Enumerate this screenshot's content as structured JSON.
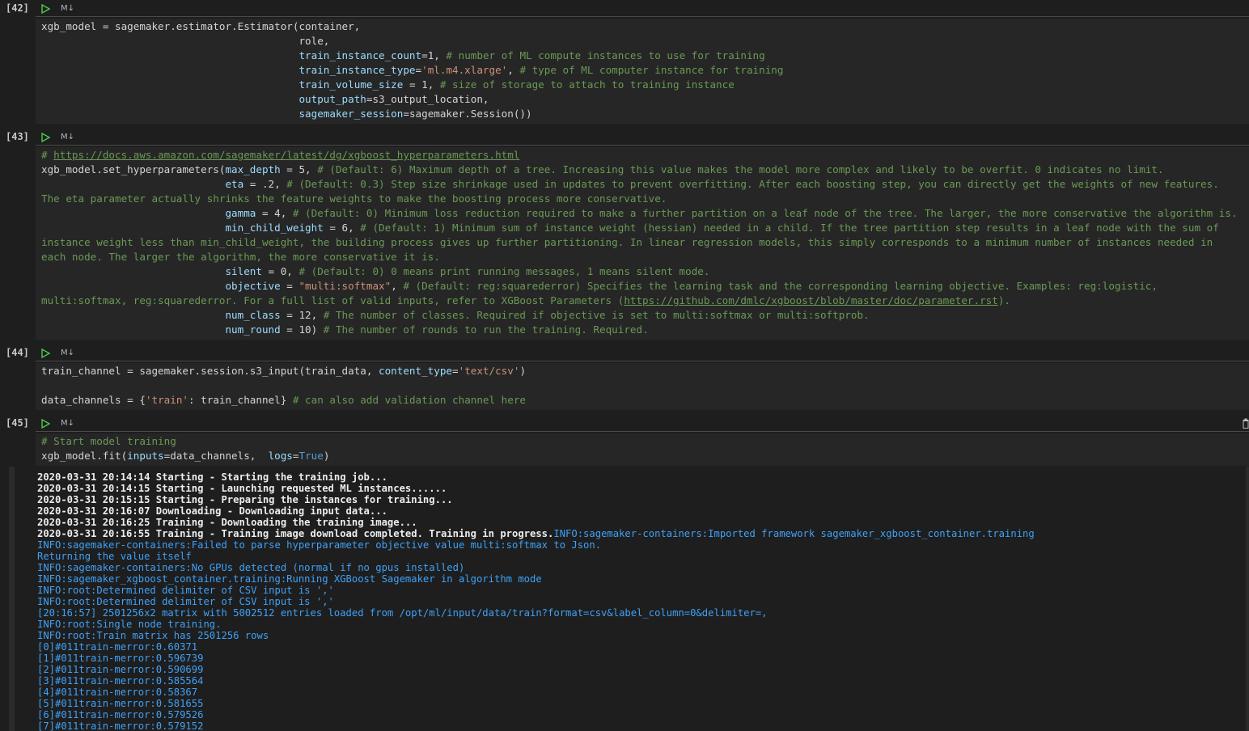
{
  "toolbar": {
    "md_label": "M↓"
  },
  "cells": [
    {
      "exec_count": "[42]",
      "code": [
        [
          [
            "",
            "xgb_model = sagemaker.estimator.Estimator(container,"
          ]
        ],
        [
          [
            "",
            "                                          role,"
          ]
        ],
        [
          [
            "",
            "                                          "
          ],
          [
            "kw",
            "train_instance_count"
          ],
          [
            "",
            "=1, "
          ],
          [
            "cm",
            "# number of ML compute instances to use for training"
          ]
        ],
        [
          [
            "",
            "                                          "
          ],
          [
            "kw",
            "train_instance_type"
          ],
          [
            "",
            "="
          ],
          [
            "st",
            "'ml.m4.xlarge'"
          ],
          [
            "",
            ", "
          ],
          [
            "cm",
            "# type of ML computer instance for training"
          ]
        ],
        [
          [
            "",
            "                                          "
          ],
          [
            "kw",
            "train_volume_size"
          ],
          [
            "",
            " = 1, "
          ],
          [
            "cm",
            "# size of storage to attach to training instance"
          ]
        ],
        [
          [
            "",
            "                                          "
          ],
          [
            "kw",
            "output_path"
          ],
          [
            "",
            "=s3_output_location,"
          ]
        ],
        [
          [
            "",
            "                                          "
          ],
          [
            "kw",
            "sagemaker_session"
          ],
          [
            "",
            "=sagemaker.Session())"
          ]
        ]
      ]
    },
    {
      "exec_count": "[43]",
      "code": [
        [
          [
            "cm",
            "# "
          ],
          [
            "cm lnk",
            "https://docs.aws.amazon.com/sagemaker/latest/dg/xgboost_hyperparameters.html"
          ]
        ],
        [
          [
            "",
            "xgb_model.set_hyperparameters("
          ],
          [
            "kw",
            "max_depth"
          ],
          [
            "",
            " = 5, "
          ],
          [
            "cm",
            "# (Default: 6) Maximum depth of a tree. Increasing this value makes the model more complex and likely to be overfit. 0 indicates no limit."
          ]
        ],
        [
          [
            "",
            "                              "
          ],
          [
            "kw",
            "eta"
          ],
          [
            "",
            " = .2, "
          ],
          [
            "cm",
            "# (Default: 0.3) Step size shrinkage used in updates to prevent overfitting. After each boosting step, you can directly get the weights of new features."
          ]
        ],
        [
          [
            "cm",
            "The eta parameter actually shrinks the feature weights to make the boosting process more conservative."
          ]
        ],
        [
          [
            "",
            "                              "
          ],
          [
            "kw",
            "gamma"
          ],
          [
            "",
            " = 4, "
          ],
          [
            "cm",
            "# (Default: 0) Minimum loss reduction required to make a further partition on a leaf node of the tree. The larger, the more conservative the algorithm is."
          ]
        ],
        [
          [
            "",
            "                              "
          ],
          [
            "kw",
            "min_child_weight"
          ],
          [
            "",
            " = 6, "
          ],
          [
            "cm",
            "# (Default: 1) Minimum sum of instance weight (hessian) needed in a child. If the tree partition step results in a leaf node with the sum of"
          ]
        ],
        [
          [
            "cm",
            "instance weight less than min_child_weight, the building process gives up further partitioning. In linear regression models, this simply corresponds to a minimum number of instances needed in"
          ]
        ],
        [
          [
            "cm",
            "each node. The larger the algorithm, the more conservative it is."
          ]
        ],
        [
          [
            "",
            "                              "
          ],
          [
            "kw",
            "silent"
          ],
          [
            "",
            " = 0, "
          ],
          [
            "cm",
            "# (Default: 0) 0 means print running messages, 1 means silent mode."
          ]
        ],
        [
          [
            "",
            "                              "
          ],
          [
            "kw",
            "objective"
          ],
          [
            "",
            " = "
          ],
          [
            "st",
            "\"multi:softmax\""
          ],
          [
            "",
            ", "
          ],
          [
            "cm",
            "# (Default: reg:squarederror) Specifies the learning task and the corresponding learning objective. Examples: reg:logistic,"
          ]
        ],
        [
          [
            "cm",
            "multi:softmax, reg:squarederror. For a full list of valid inputs, refer to XGBoost Parameters ("
          ],
          [
            "cm lnk",
            "https://github.com/dmlc/xgboost/blob/master/doc/parameter.rst"
          ],
          [
            "cm",
            ")."
          ]
        ],
        [
          [
            "",
            "                              "
          ],
          [
            "kw",
            "num_class"
          ],
          [
            "",
            " = 12, "
          ],
          [
            "cm",
            "# The number of classes. Required if objective is set to multi:softmax or multi:softprob."
          ]
        ],
        [
          [
            "",
            "                              "
          ],
          [
            "kw",
            "num_round"
          ],
          [
            "",
            " = 10) "
          ],
          [
            "cm",
            "# The number of rounds to run the training. Required."
          ]
        ]
      ]
    },
    {
      "exec_count": "[44]",
      "code": [
        [
          [
            "",
            "train_channel = sagemaker.session.s3_input(train_data, "
          ],
          [
            "kw",
            "content_type"
          ],
          [
            "",
            "="
          ],
          [
            "st",
            "'text/csv'"
          ],
          [
            "",
            ")"
          ]
        ],
        [
          [
            "",
            ""
          ]
        ],
        [
          [
            "",
            "data_channels = {"
          ],
          [
            "st",
            "'train'"
          ],
          [
            "",
            ": train_channel} "
          ],
          [
            "cm",
            "# can also add validation channel here"
          ]
        ]
      ]
    },
    {
      "exec_count": "[45]",
      "code": [
        [
          [
            "cm",
            "# Start model training"
          ]
        ],
        [
          [
            "",
            "xgb_model.fit("
          ],
          [
            "kw",
            "inputs"
          ],
          [
            "",
            "=data_channels,  "
          ],
          [
            "kw",
            "logs"
          ],
          [
            "",
            "="
          ],
          [
            "bl",
            "True"
          ],
          [
            "",
            ")"
          ]
        ]
      ]
    }
  ],
  "output": [
    [
      [
        "w",
        "2020-03-31 20:14:14 Starting - Starting the training job..."
      ]
    ],
    [
      [
        "w",
        "2020-03-31 20:14:15 Starting - Launching requested ML instances......"
      ]
    ],
    [
      [
        "w",
        "2020-03-31 20:15:15 Starting - Preparing the instances for training..."
      ]
    ],
    [
      [
        "w",
        "2020-03-31 20:16:07 Downloading - Downloading input data..."
      ]
    ],
    [
      [
        "w",
        "2020-03-31 20:16:25 Training - Downloading the training image..."
      ]
    ],
    [
      [
        "w",
        "2020-03-31 20:16:55 Training - Training image download completed. Training in progress."
      ],
      [
        "b",
        "INFO:sagemaker-containers:Imported framework sagemaker_xgboost_container.training"
      ]
    ],
    [
      [
        "b",
        "INFO:sagemaker-containers:Failed to parse hyperparameter objective value multi:softmax to Json."
      ]
    ],
    [
      [
        "b",
        "Returning the value itself"
      ]
    ],
    [
      [
        "b",
        "INFO:sagemaker-containers:No GPUs detected (normal if no gpus installed)"
      ]
    ],
    [
      [
        "b",
        "INFO:sagemaker_xgboost_container.training:Running XGBoost Sagemaker in algorithm mode"
      ]
    ],
    [
      [
        "b",
        "INFO:root:Determined delimiter of CSV input is ','"
      ]
    ],
    [
      [
        "b",
        "INFO:root:Determined delimiter of CSV input is ','"
      ]
    ],
    [
      [
        "b",
        "[20:16:57] 2501256x2 matrix with 5002512 entries loaded from /opt/ml/input/data/train?format=csv&label_column=0&delimiter=,"
      ]
    ],
    [
      [
        "b",
        "INFO:root:Single node training."
      ]
    ],
    [
      [
        "b",
        "INFO:root:Train matrix has 2501256 rows"
      ]
    ],
    [
      [
        "b",
        "[0]#011train-merror:0.60371"
      ]
    ],
    [
      [
        "b",
        "[1]#011train-merror:0.596739"
      ]
    ],
    [
      [
        "b",
        "[2]#011train-merror:0.590699"
      ]
    ],
    [
      [
        "b",
        "[3]#011train-merror:0.585564"
      ]
    ],
    [
      [
        "b",
        "[4]#011train-merror:0.58367"
      ]
    ],
    [
      [
        "b",
        "[5]#011train-merror:0.581655"
      ]
    ],
    [
      [
        "b",
        "[6]#011train-merror:0.579526"
      ]
    ],
    [
      [
        "b",
        "[7]#011train-merror:0.579152"
      ]
    ]
  ],
  "colors": {
    "background": "#1e1e1e",
    "code_bg": "#262626",
    "keyword": "#9cdcfe",
    "comment": "#6a9955",
    "string": "#ce9178",
    "output_info": "#3fa1f7",
    "run_icon": "#4ec94e"
  },
  "icons": [
    "run-icon",
    "markdown-icon",
    "trash-icon"
  ]
}
